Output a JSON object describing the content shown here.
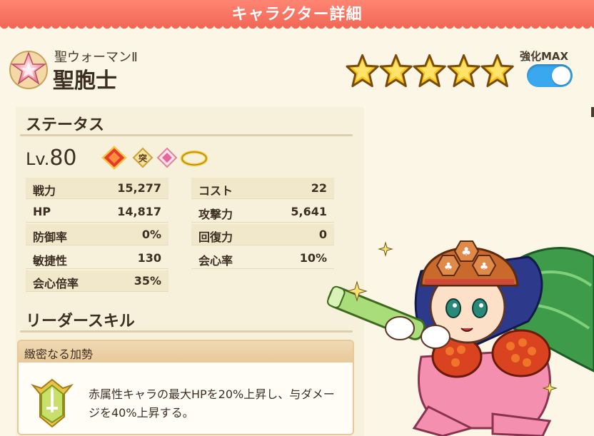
{
  "header": {
    "title": "キャラクター詳細"
  },
  "character": {
    "subtitle": "聖ウォーマンⅡ",
    "name": "聖胞士",
    "stars": 5,
    "enhance_label": "強化MAX",
    "enhance_on": true
  },
  "status": {
    "title": "ステータス",
    "level_prefix": "Lv.",
    "level": "80",
    "attribute_icons": [
      "fire-diamond-icon",
      "break-badge-icon",
      "pink-diamond-icon",
      "halo-ring-icon"
    ],
    "attribute_badge_text": "突",
    "left": [
      {
        "label": "戦力",
        "value": "15,277"
      },
      {
        "label": "HP",
        "value": "14,817"
      },
      {
        "label": "防御率",
        "value": "0%"
      },
      {
        "label": "敏捷性",
        "value": "130"
      },
      {
        "label": "会心倍率",
        "value": "35%"
      }
    ],
    "right": [
      {
        "label": "コスト",
        "value": "22"
      },
      {
        "label": "攻撃力",
        "value": "5,641"
      },
      {
        "label": "回復力",
        "value": "0"
      },
      {
        "label": "会心率",
        "value": "10%"
      }
    ]
  },
  "leader_skill": {
    "title": "リーダースキル",
    "name": "緻密なる加勢",
    "description": "赤属性キャラの最大HPを20%上昇し、与ダメージを40%上昇する。"
  },
  "colors": {
    "header": "#f26a57",
    "toggle": "#39a8ef",
    "star": "#f5c518",
    "panel": "#f7f0da"
  }
}
